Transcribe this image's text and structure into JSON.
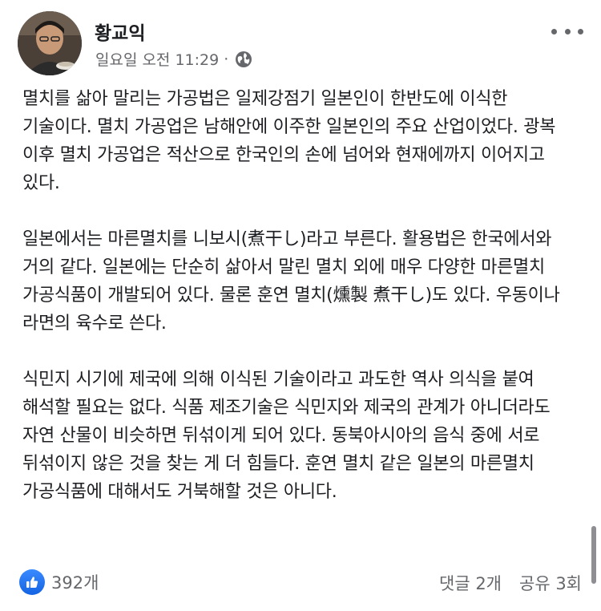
{
  "post": {
    "author": "황교익",
    "day": "일요일",
    "time": "오전 11:29",
    "separator": "·",
    "privacy_icon": "globe-icon",
    "more_icon": "more-dots-icon"
  },
  "body": {
    "paragraphs": [
      "멸치를 삶아 말리는 가공법은 일제강점기 일본인이 한반도에 이식한 기술이다. 멸치 가공업은 남해안에 이주한 일본인의 주요 산업이었다. 광복 이후 멸치 가공업은 적산으로 한국인의 손에 넘어와 현재에까지 이어지고 있다.",
      "일본에서는 마른멸치를 니보시(煮干し)라고 부른다. 활용법은 한국에서와 거의 같다. 일본에는 단순히 삶아서 말린 멸치 외에 매우 다양한 마른멸치 가공식품이 개발되어 있다. 물론 훈연 멸치(燻製 煮干し)도 있다. 우동이나 라면의 육수로 쓴다.",
      "식민지 시기에 제국에 의해 이식된 기술이라고 과도한 역사 의식을 붙여 해석할 필요는 없다. 식품 제조기술은 식민지와 제국의 관계가 아니더라도 자연 산물이 비슷하면 뒤섞이게 되어 있다. 동북아시아의 음식 중에 서로 뒤섞이지 않은 것을 찾는 게 더 힘들다. 훈연 멸치 같은 일본의 마른멸치 가공식품에 대해서도 거북해할 것은 아니다."
    ]
  },
  "footer": {
    "reaction_icon": "like-icon",
    "reaction_count": "392개",
    "comments": "댓글 2개",
    "shares": "공유 3회"
  },
  "colors": {
    "text": "#1c1e21",
    "meta": "#65676b",
    "like_blue": "#1877f2"
  }
}
